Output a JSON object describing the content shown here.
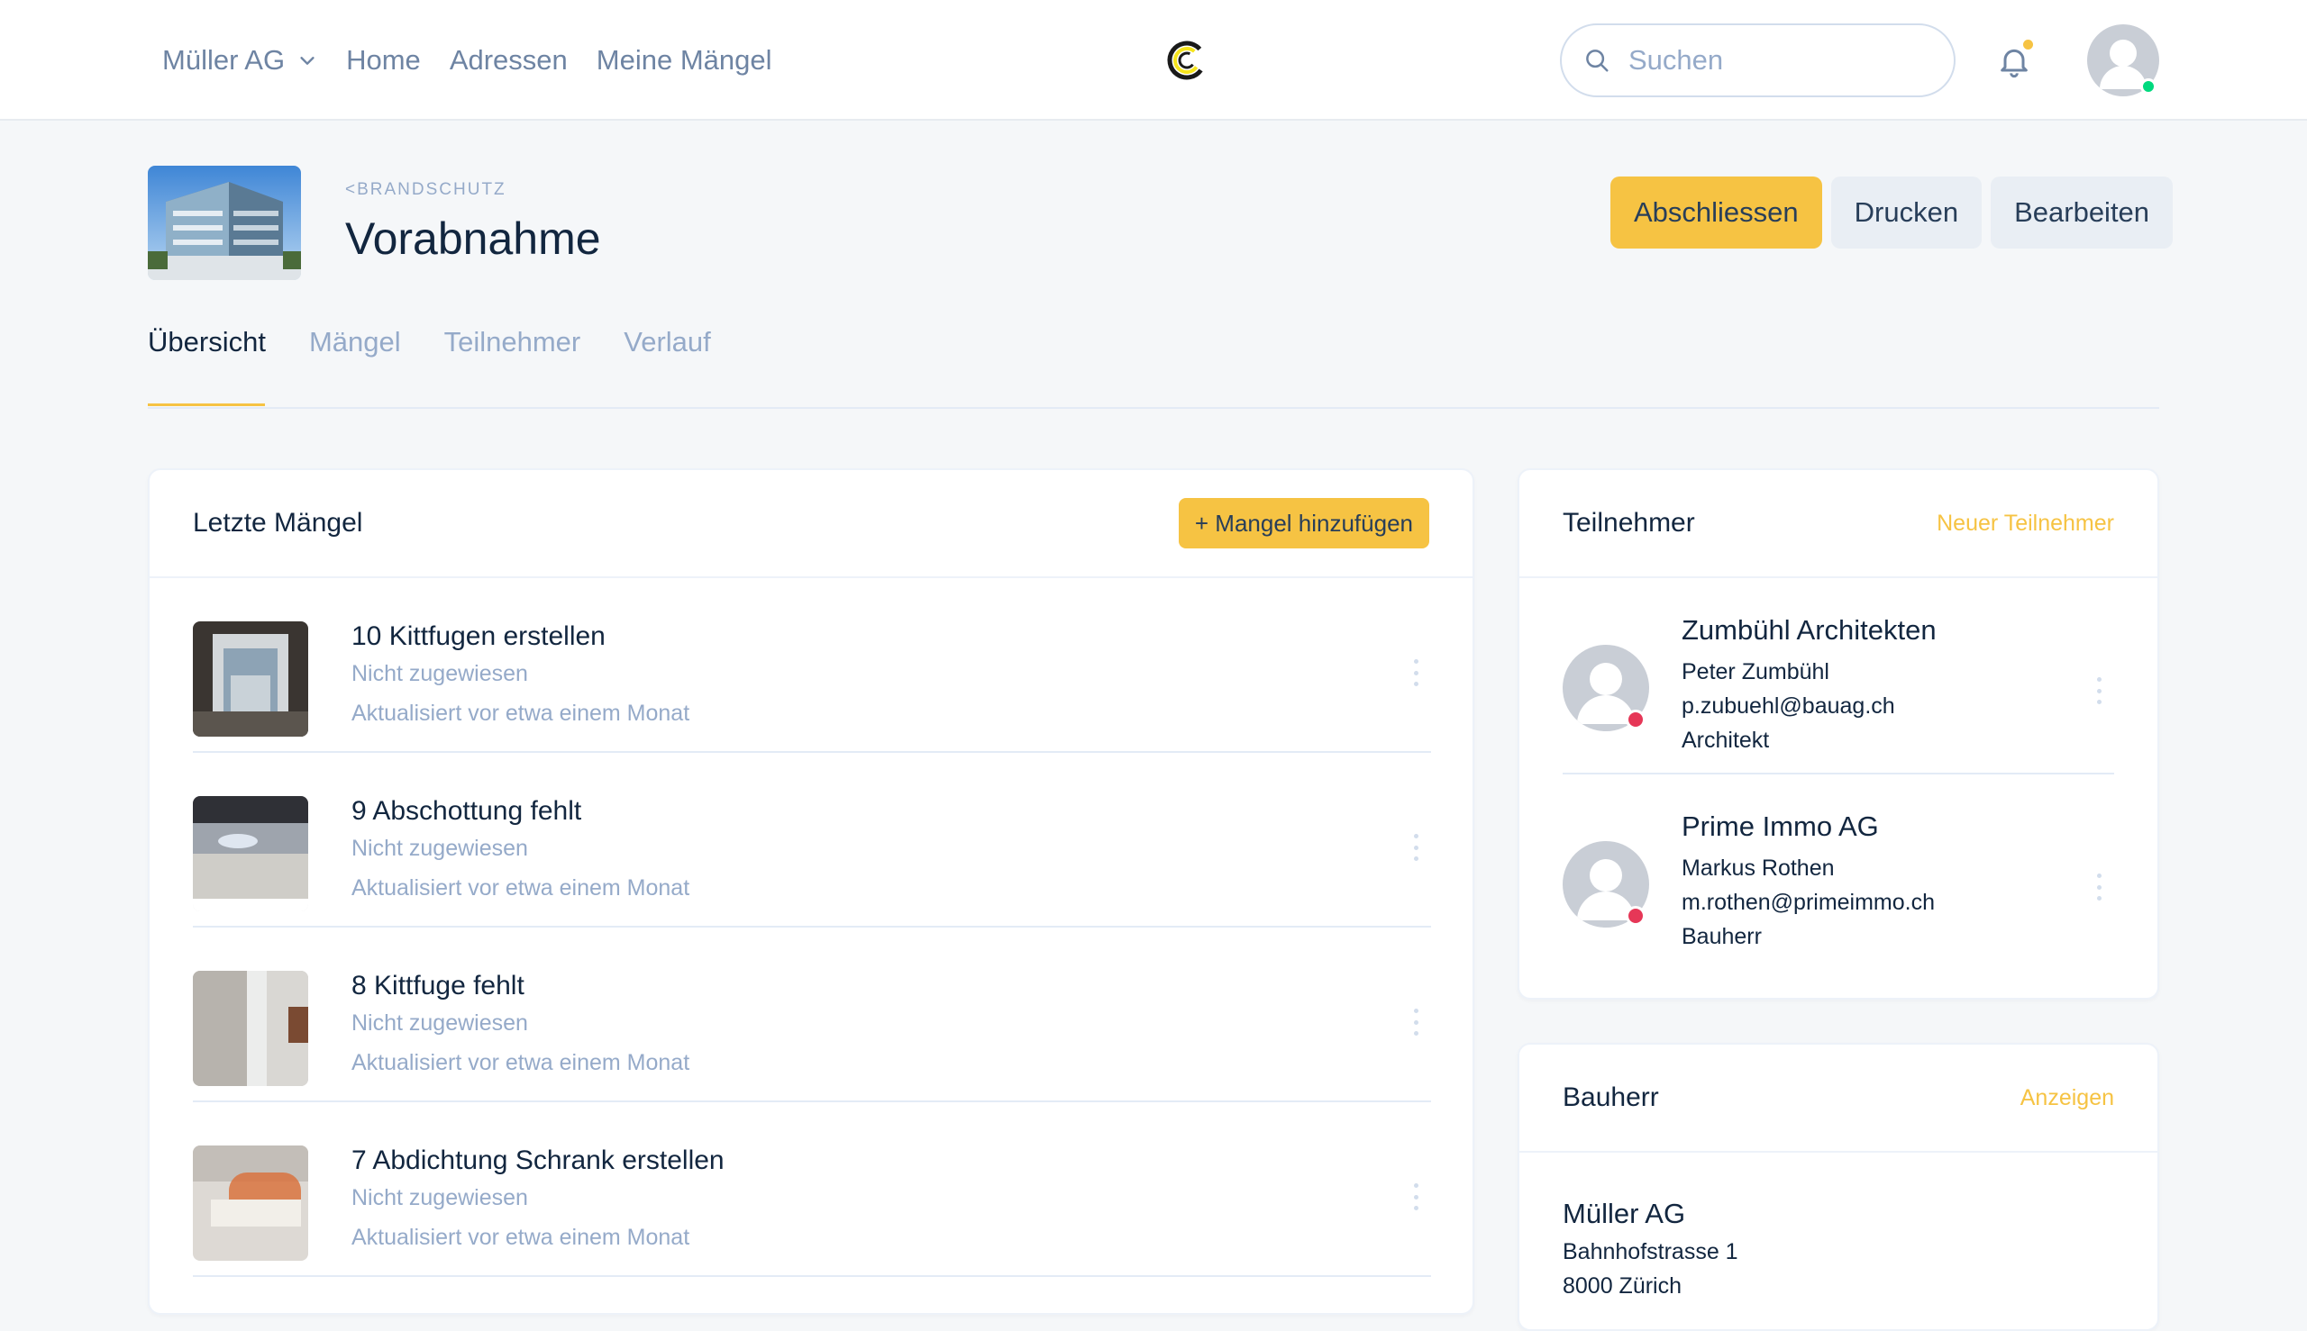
{
  "nav": {
    "company": "Müller AG",
    "links": [
      "Home",
      "Adressen",
      "Meine Mängel"
    ],
    "search_placeholder": "Suchen"
  },
  "header": {
    "pretitle": "<Brandschutz",
    "title": "Vorabnahme",
    "buttons": {
      "close": "Abschliessen",
      "print": "Drucken",
      "edit": "Bearbeiten"
    }
  },
  "tabs": [
    {
      "label": "Übersicht",
      "active": true
    },
    {
      "label": "Mängel",
      "active": false
    },
    {
      "label": "Teilnehmer",
      "active": false
    },
    {
      "label": "Verlauf",
      "active": false
    }
  ],
  "defects": {
    "title": "Letzte Mängel",
    "add_button": "+ Mangel hinzufügen",
    "items": [
      {
        "title": "10 Kittfugen erstellen",
        "assignee": "Nicht zugewiesen",
        "updated": "Aktualisiert vor etwa einem Monat"
      },
      {
        "title": "9 Abschottung fehlt",
        "assignee": "Nicht zugewiesen",
        "updated": "Aktualisiert vor etwa einem Monat"
      },
      {
        "title": "8 Kittfuge fehlt",
        "assignee": "Nicht zugewiesen",
        "updated": "Aktualisiert vor etwa einem Monat"
      },
      {
        "title": "7 Abdichtung Schrank erstellen",
        "assignee": "Nicht zugewiesen",
        "updated": "Aktualisiert vor etwa einem Monat"
      }
    ]
  },
  "participants": {
    "title": "Teilnehmer",
    "link": "Neuer Teilnehmer",
    "items": [
      {
        "org": "Zumbühl Architekten",
        "name": "Peter Zumbühl",
        "email": "p.zubuehl@bauag.ch",
        "role": "Architekt"
      },
      {
        "org": "Prime Immo AG",
        "name": "Markus Rothen",
        "email": "m.rothen@primeimmo.ch",
        "role": "Bauherr"
      }
    ]
  },
  "owner": {
    "title": "Bauherr",
    "link": "Anzeigen",
    "name": "Müller AG",
    "street": "Bahnhofstrasse 1",
    "city": "8000 Zürich"
  },
  "colors": {
    "accent": "#f6c343",
    "online": "#00d97e",
    "offline": "#e63757",
    "muted": "#95aac9",
    "text": "#12263f"
  }
}
